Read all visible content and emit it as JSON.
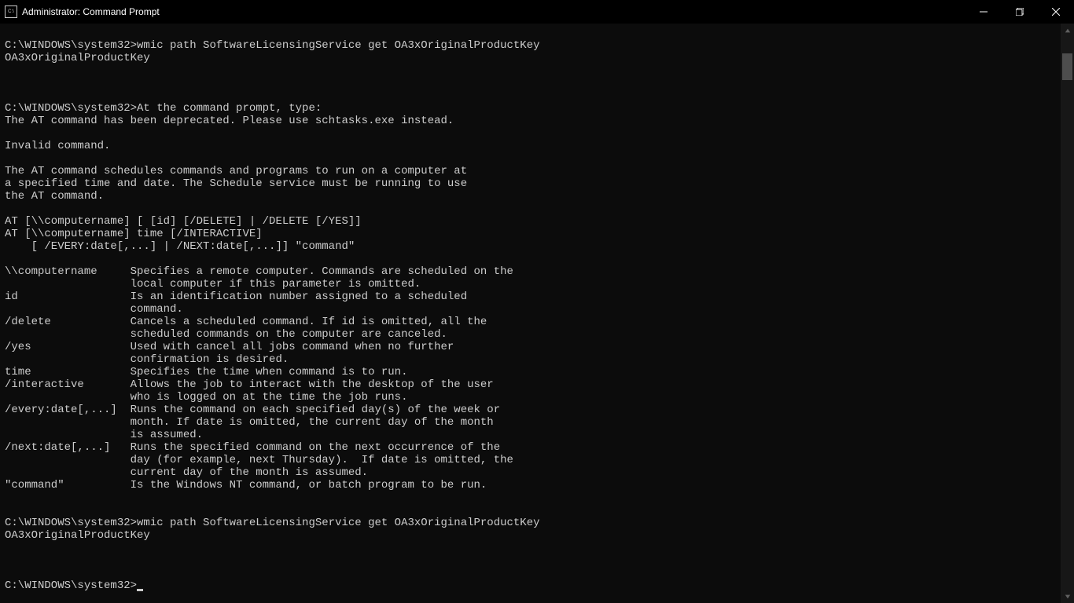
{
  "window": {
    "title": "Administrator: Command Prompt"
  },
  "prompt": "C:\\WINDOWS\\system32>",
  "terminal": {
    "lines": [
      "",
      "C:\\WINDOWS\\system32>wmic path SoftwareLicensingService get OA3xOriginalProductKey",
      "OA3xOriginalProductKey",
      "",
      "",
      "",
      "C:\\WINDOWS\\system32>At the command prompt, type:",
      "The AT command has been deprecated. Please use schtasks.exe instead.",
      "",
      "Invalid command.",
      "",
      "The AT command schedules commands and programs to run on a computer at",
      "a specified time and date. The Schedule service must be running to use",
      "the AT command.",
      "",
      "AT [\\\\computername] [ [id] [/DELETE] | /DELETE [/YES]]",
      "AT [\\\\computername] time [/INTERACTIVE]",
      "    [ /EVERY:date[,...] | /NEXT:date[,...]] \"command\"",
      "",
      "\\\\computername     Specifies a remote computer. Commands are scheduled on the",
      "                   local computer if this parameter is omitted.",
      "id                 Is an identification number assigned to a scheduled",
      "                   command.",
      "/delete            Cancels a scheduled command. If id is omitted, all the",
      "                   scheduled commands on the computer are canceled.",
      "/yes               Used with cancel all jobs command when no further",
      "                   confirmation is desired.",
      "time               Specifies the time when command is to run.",
      "/interactive       Allows the job to interact with the desktop of the user",
      "                   who is logged on at the time the job runs.",
      "/every:date[,...]  Runs the command on each specified day(s) of the week or",
      "                   month. If date is omitted, the current day of the month",
      "                   is assumed.",
      "/next:date[,...]   Runs the specified command on the next occurrence of the",
      "                   day (for example, next Thursday).  If date is omitted, the",
      "                   current day of the month is assumed.",
      "\"command\"          Is the Windows NT command, or batch program to be run.",
      "",
      "",
      "C:\\WINDOWS\\system32>wmic path SoftwareLicensingService get OA3xOriginalProductKey",
      "OA3xOriginalProductKey",
      "",
      "",
      ""
    ]
  }
}
